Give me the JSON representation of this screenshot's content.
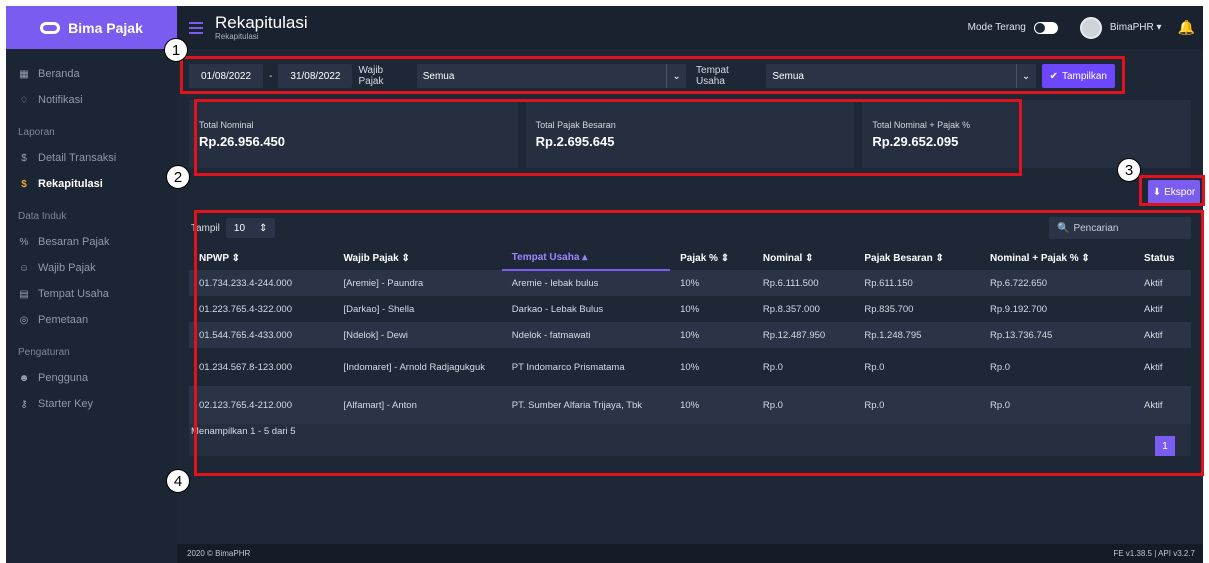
{
  "brand": {
    "name": "Bima Pajak"
  },
  "sidebar": {
    "items": [
      {
        "type": "item",
        "label": "Beranda",
        "icon": "grid-icon"
      },
      {
        "type": "item",
        "label": "Notifikasi",
        "icon": "bell-icon"
      },
      {
        "type": "section",
        "label": "Laporan"
      },
      {
        "type": "item",
        "label": "Detail Transaksi",
        "icon": "dollar-icon"
      },
      {
        "type": "item",
        "label": "Rekapitulasi",
        "icon": "dollar-icon",
        "active": true
      },
      {
        "type": "section",
        "label": "Data Induk"
      },
      {
        "type": "item",
        "label": "Besaran Pajak",
        "icon": "percent-icon"
      },
      {
        "type": "item",
        "label": "Wajib Pajak",
        "icon": "user-icon"
      },
      {
        "type": "item",
        "label": "Tempat Usaha",
        "icon": "store-icon"
      },
      {
        "type": "item",
        "label": "Pemetaan",
        "icon": "map-pin-icon"
      },
      {
        "type": "section",
        "label": "Pengaturan"
      },
      {
        "type": "item",
        "label": "Pengguna",
        "icon": "users-icon"
      },
      {
        "type": "item",
        "label": "Starter Key",
        "icon": "key-icon"
      }
    ]
  },
  "header": {
    "title": "Rekapitulasi",
    "subtitle": "Rekapitulasi",
    "mode_label": "Mode Terang",
    "user": "BimaPHR"
  },
  "filter": {
    "date_from": "01/08/2022",
    "date_sep": "-",
    "date_to": "31/08/2022",
    "wajib_label": "Wajib Pajak",
    "wajib_value": "Semua",
    "tempat_label": "Tempat Usaha",
    "tempat_value": "Semua",
    "button": "Tampilkan"
  },
  "cards": [
    {
      "label": "Total Nominal",
      "value": "Rp.26.956.450"
    },
    {
      "label": "Total Pajak Besaran",
      "value": "Rp.2.695.645"
    },
    {
      "label": "Total Nominal + Pajak %",
      "value": "Rp.29.652.095"
    }
  ],
  "ekspor_label": "Ekspor",
  "table": {
    "show_label": "Tampil",
    "page_size": "10",
    "search_placeholder": "Pencarian",
    "columns": [
      "NPWP",
      "Wajib Pajak",
      "Tempat Usaha",
      "Pajak %",
      "Nominal",
      "Pajak Besaran",
      "Nominal + Pajak %",
      "Status"
    ],
    "sorted_column": "Tempat Usaha",
    "rows": [
      [
        "01.734.233.4-244.000",
        "[Aremie] - Paundra",
        "Aremie - lebak bulus",
        "10%",
        "Rp.6.111.500",
        "Rp.611.150",
        "Rp.6.722.650",
        "Aktif"
      ],
      [
        "01.223.765.4-322.000",
        "[Darkao] - Shella",
        "Darkao - Lebak Bulus",
        "10%",
        "Rp.8.357.000",
        "Rp.835.700",
        "Rp.9.192.700",
        "Aktif"
      ],
      [
        "01.544.765.4-433.000",
        "[Ndelok] - Dewi",
        "Ndelok - fatmawati",
        "10%",
        "Rp.12.487.950",
        "Rp.1.248.795",
        "Rp.13.736.745",
        "Aktif"
      ],
      [
        "01.234.567.8-123.000",
        "[Indomaret] - Arnold Radjagukguk",
        "PT Indomarco Prismatama",
        "10%",
        "Rp.0",
        "Rp.0",
        "Rp.0",
        "Aktif"
      ],
      [
        "02.123.765.4-212.000",
        "[Alfamart] - Anton",
        "PT. Sumber Alfaria Trijaya, Tbk",
        "10%",
        "Rp.0",
        "Rp.0",
        "Rp.0",
        "Aktif"
      ]
    ],
    "info": "Menampilkan 1 - 5 dari 5",
    "current_page": "1"
  },
  "footer": {
    "left": "2020 © BimaPHR",
    "right": "FE v1.38.5 | API v3.2.7"
  },
  "annotations": [
    "1",
    "2",
    "3",
    "4"
  ],
  "colors": {
    "accent": "#7b5cf0",
    "highlight": "#e0131d",
    "background": "#1e2736"
  }
}
